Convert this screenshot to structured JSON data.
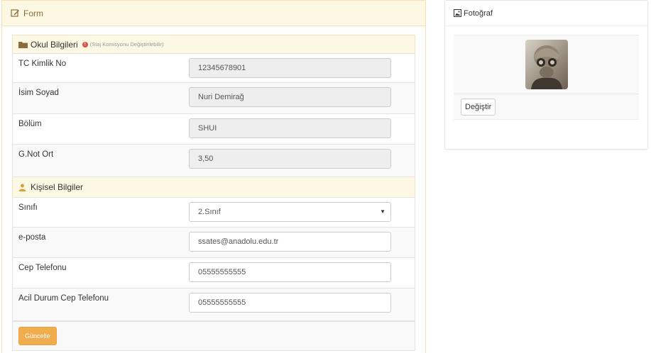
{
  "form_panel": {
    "title": "Form",
    "school_section": {
      "title": "Okul Bilgileri",
      "note": "(Staj Komisyonu Değiştirilebilir)",
      "fields": [
        {
          "label": "TC Kimlik No",
          "value": "12345678901"
        },
        {
          "label": "İsim Soyad",
          "value": "Nuri Demirağ"
        },
        {
          "label": "Bölüm",
          "value": "SHUI"
        },
        {
          "label": "G.Not Ort",
          "value": "3,50"
        }
      ]
    },
    "personal_section": {
      "title": "Kişisel Bilgiler",
      "fields": [
        {
          "label": "Sınıfı",
          "value": "2.Sınıf"
        },
        {
          "label": "e-posta",
          "value": "ssates@anadolu.edu.tr"
        },
        {
          "label": "Cep Telefonu",
          "value": "05555555555"
        },
        {
          "label": "Acil Durum Cep Telefonu",
          "value": "05555555555"
        }
      ]
    },
    "update_button": "Güncelle"
  },
  "photo_panel": {
    "title": "Fotoğraf",
    "change_button": "Değiştir"
  },
  "colors": {
    "heading_bg": "#fcf8e3",
    "heading_text": "#8a6d3b",
    "warning_button": "#f0ad4e",
    "warn_icon": "#d9534f"
  },
  "icons": {
    "form_heading": "edit-icon",
    "school_section": "folder-icon",
    "personal_section": "user-icon",
    "photo_heading": "image-icon"
  }
}
